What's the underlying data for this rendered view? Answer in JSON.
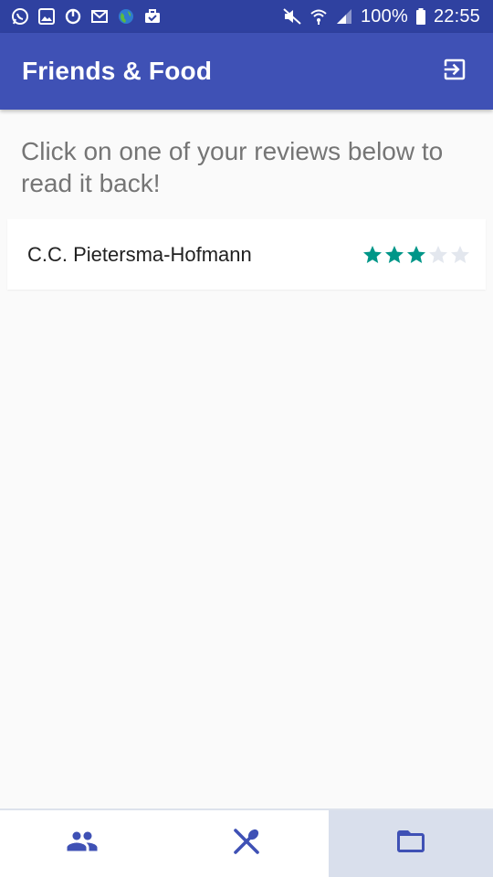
{
  "status_bar": {
    "left_icons": [
      "whatsapp-icon",
      "gallery-icon",
      "sync-icon",
      "gmail-icon",
      "globe-icon",
      "briefcase-icon"
    ],
    "right_icons": [
      "mute-icon",
      "wifi-icon",
      "signal-icon",
      "battery-icon"
    ],
    "battery": "100%",
    "time": "22:55"
  },
  "app_bar": {
    "title": "Friends & Food",
    "action_icon": "exit-to-app-icon"
  },
  "main": {
    "instructions": "Click on one of your reviews below to read it back!",
    "reviews": [
      {
        "name": "C.C. Pietersma-Hofmann",
        "rating": 3,
        "max_rating": 5
      }
    ]
  },
  "bottom_nav": {
    "items": [
      {
        "icon": "friends-icon",
        "active": false
      },
      {
        "icon": "food-icon",
        "active": false
      },
      {
        "icon": "folder-icon",
        "active": true
      }
    ]
  },
  "colors": {
    "status_bar": "#2f41a0",
    "primary": "#3f51b5",
    "star_filled": "#009688",
    "star_empty": "#e3e7ee",
    "nav_icon": "#3f51b5",
    "nav_active_bg": "#d9dfec"
  }
}
